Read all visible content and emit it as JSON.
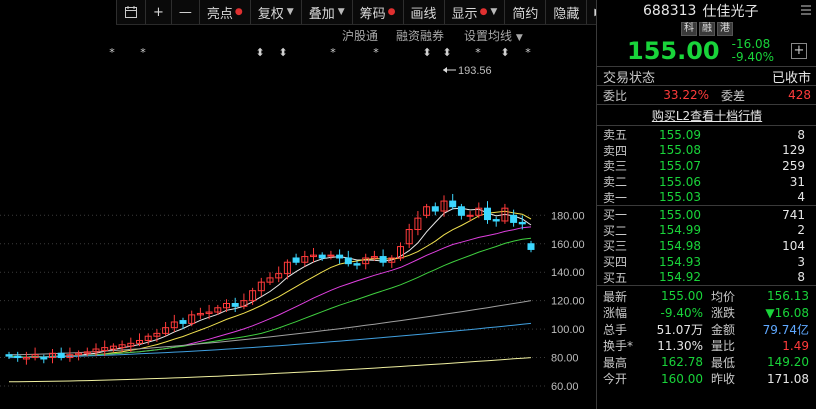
{
  "toolbar": {
    "items": [
      {
        "label": "亮点",
        "dot": true
      },
      {
        "label": "复权",
        "caret": true
      },
      {
        "label": "叠加",
        "caret": true
      },
      {
        "label": "筹码",
        "dot": true
      },
      {
        "label": "画线"
      },
      {
        "label": "显示",
        "dot": true,
        "caret": true
      },
      {
        "label": "简约"
      },
      {
        "label": "隐藏"
      }
    ],
    "icons": [
      "calendar-icon",
      "zoom-in-icon",
      "zoom-out-icon",
      "expand-icon"
    ],
    "plus": "+",
    "minus": "—"
  },
  "subtabs": [
    "沪股通",
    "融资融券",
    "设置均线"
  ],
  "chart": {
    "y_ticks": [
      "180.00",
      "160.00",
      "140.00",
      "120.00",
      "100.00",
      "80.00",
      "60.00"
    ],
    "max_label": "193.56",
    "markers": [
      "*",
      "*",
      "⬍",
      "⬍",
      "*",
      "*",
      "⬍",
      "⬍",
      "*",
      "⬍",
      "*",
      "*",
      "⬍"
    ],
    "colors": {
      "up": "#ff3b3b",
      "down": "#3cd7ff",
      "ma5": "#e8e8e8",
      "ma10": "#f0e050",
      "ma20": "#e040e0",
      "ma30": "#40d040",
      "ma60": "#a0a0a0",
      "ma120": "#40a0e0",
      "ma250": "#f0f0a0"
    }
  },
  "quote": {
    "code": "688313",
    "name": "仕佳光子",
    "badges": [
      "科",
      "融",
      "港"
    ],
    "price": "155.00",
    "change": "-16.08",
    "change_pct": "-9.40%",
    "status_label": "交易状态",
    "status_value": "已收市",
    "weibi_label": "委比",
    "weibi_value": "33.22%",
    "weicha_label": "委差",
    "weicha_value": "428",
    "l2_link": "购买L2查看十档行情"
  },
  "orderbook": {
    "asks": [
      {
        "label": "卖五",
        "price": "155.09",
        "vol": "8"
      },
      {
        "label": "卖四",
        "price": "155.08",
        "vol": "129"
      },
      {
        "label": "卖三",
        "price": "155.07",
        "vol": "259"
      },
      {
        "label": "卖二",
        "price": "155.06",
        "vol": "31"
      },
      {
        "label": "卖一",
        "price": "155.03",
        "vol": "4"
      }
    ],
    "bids": [
      {
        "label": "买一",
        "price": "155.00",
        "vol": "741"
      },
      {
        "label": "买二",
        "price": "154.99",
        "vol": "2"
      },
      {
        "label": "买三",
        "price": "154.98",
        "vol": "104"
      },
      {
        "label": "买四",
        "price": "154.93",
        "vol": "3"
      },
      {
        "label": "买五",
        "price": "154.92",
        "vol": "8"
      }
    ]
  },
  "stats": {
    "latest_l": "最新",
    "latest_v": "155.00",
    "avg_l": "均价",
    "avg_v": "156.13",
    "pct_l": "涨幅",
    "pct_v": "-9.40%",
    "chg_l": "涨跌",
    "chg_v": "▼16.08",
    "vol_l": "总手",
    "vol_v": "51.07万",
    "amt_l": "金额",
    "amt_v": "79.74亿",
    "turn_l": "换手*",
    "turn_v": "11.30%",
    "ratio_l": "量比",
    "ratio_v": "1.49",
    "high_l": "最高",
    "high_v": "162.78",
    "low_l": "最低",
    "low_v": "149.20",
    "open_l": "今开",
    "open_v": "160.00",
    "prev_l": "昨收",
    "prev_v": "171.08"
  }
}
